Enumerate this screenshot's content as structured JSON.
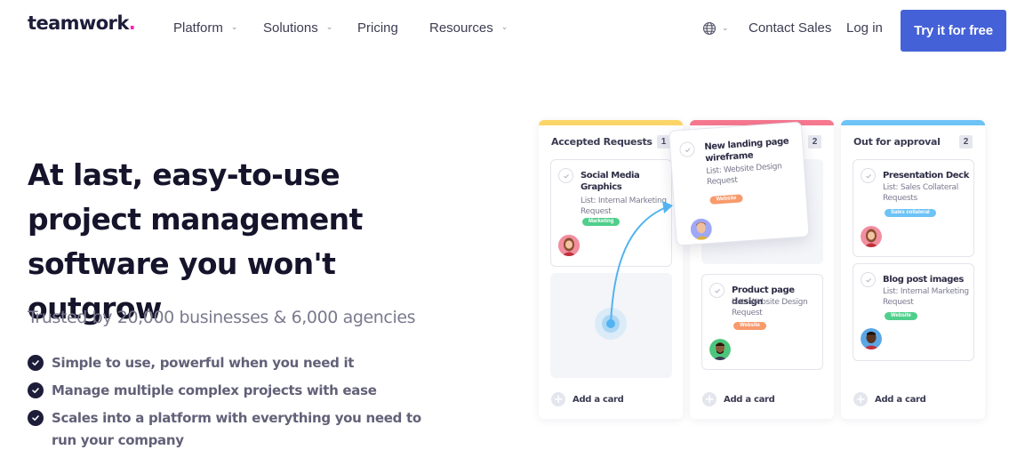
{
  "nav": {
    "logo": "teamwork",
    "logo_dot": ".",
    "items": [
      {
        "label": "Platform",
        "has_dropdown": true,
        "icon": "chevron-down-icon"
      },
      {
        "label": "Solutions",
        "has_dropdown": true,
        "icon": "chevron-down-icon"
      },
      {
        "label": "Pricing",
        "has_dropdown": false
      },
      {
        "label": "Resources",
        "has_dropdown": true,
        "icon": "chevron-down-icon"
      }
    ],
    "language_icon": "globe-icon",
    "contact_sales": "Contact Sales",
    "login": "Log in",
    "cta": "Try it for free",
    "chevron_glyph": "⌄"
  },
  "hero": {
    "headline": "At last, easy-to-use project management software you won't outgrow",
    "subheadline": "Trusted by 20,000 businesses & 6,000 agencies",
    "bullets": [
      "Simple to use, powerful when you need it",
      "Manage multiple complex projects with ease",
      "Scales into a platform with everything you need to run your company"
    ]
  },
  "board": {
    "columns": [
      {
        "title": "Accepted Requests",
        "count": "1",
        "color": "#fdd467",
        "cards": [
          {
            "title": "Social Media Graphics",
            "list": "List: Internal Marketing Request",
            "tag": "Marketing",
            "tag_color": "#4fcf8b"
          }
        ],
        "add_label": "Add a card"
      },
      {
        "title": "",
        "count": "2",
        "color": "#f6788f",
        "cards": [
          {
            "title": "Product page design",
            "list": "List: Website Design Request",
            "tag": "Website",
            "tag_color": "#f79a6c"
          }
        ],
        "add_label": "Add a card"
      },
      {
        "title": "Out for approval",
        "count": "2",
        "color": "#6dc3f5",
        "cards": [
          {
            "title": "Presentation Deck",
            "list": "List: Sales Collateral Requests",
            "tag": "Sales collateral",
            "tag_color": "#6dc3f5"
          },
          {
            "title": "Blog post images",
            "list": "List: Internal Marketing Request",
            "tag": "Website",
            "tag_color": "#4fcf8b"
          }
        ],
        "add_label": "Add a card"
      }
    ],
    "dragging_card": {
      "title": "New landing page wireframe",
      "list": "List: Website Design Request",
      "tag": "Website",
      "tag_color": "#f79a6c"
    }
  },
  "colors": {
    "brand_dot": "#ff22b1",
    "cta_bg": "#4461d7",
    "drag_arrow": "#52b3f0"
  }
}
